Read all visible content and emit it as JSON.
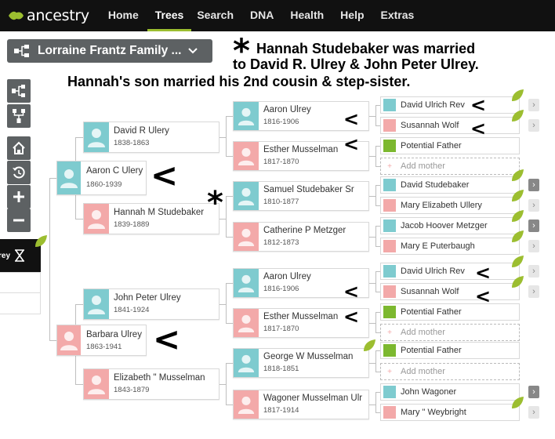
{
  "nav": {
    "logo": "ancestry",
    "items": [
      "Home",
      "Trees",
      "Search",
      "DNA",
      "Health",
      "Help",
      "Extras"
    ],
    "active": "Trees"
  },
  "tree_selector": {
    "label": "Lorraine Frantz Family ..."
  },
  "annotations": {
    "line1": "Hannah Studebaker was married",
    "line2": "to David R. Ulrey & John Peter Ulrey.",
    "line3": "Hannah's son married his 2nd cousin & step-sister.",
    "asterisk": "*",
    "lt": "<"
  },
  "side_panel": {
    "label": "Ulrey"
  },
  "people": {
    "aaron_c": {
      "name": "Aaron C Ulery",
      "dates": "1860-1939"
    },
    "barbara": {
      "name": "Barbara Ulrey",
      "dates": "1863-1941"
    },
    "david_r": {
      "name": "David R Ulery",
      "dates": "1838-1863"
    },
    "hannah": {
      "name": "Hannah M Studebaker",
      "dates": "1839-1889"
    },
    "john_peter": {
      "name": "John Peter Ulrey",
      "dates": "1841-1924"
    },
    "elizabeth": {
      "name": "Elizabeth \" Musselman",
      "dates": "1843-1879"
    },
    "aaron1": {
      "name": "Aaron Ulrey",
      "dates": "1816-1906"
    },
    "esther1": {
      "name": "Esther Musselman",
      "dates": "1817-1870"
    },
    "samuel": {
      "name": "Samuel Studebaker Sr",
      "dates": "1810-1877"
    },
    "catherine": {
      "name": "Catherine P Metzger",
      "dates": "1812-1873"
    },
    "aaron2": {
      "name": "Aaron Ulrey",
      "dates": "1816-1906"
    },
    "esther2": {
      "name": "Esther Musselman",
      "dates": "1817-1870"
    },
    "george": {
      "name": "George W Musselman",
      "dates": "1818-1851"
    },
    "wagoner": {
      "name": "Wagoner Musselman Ulr",
      "dates": "1817-1914"
    }
  },
  "small": {
    "s1": "David Ulrich Rev",
    "s2": "Susannah Wolf",
    "s3": "Potential Father",
    "s4": "Add mother",
    "s5": "David Studebaker",
    "s6": "Mary Elizabeth Ullery",
    "s7": "Jacob Hoover Metzger",
    "s8": "Mary E Puterbaugh",
    "s9": "David Ulrich Rev",
    "s10": "Susannah Wolf",
    "s11": "Potential Father",
    "s12": "Add mother",
    "s13": "Potential Father",
    "s14": "Add mother",
    "s15": "John Wagoner",
    "s16": "Mary \" Weybright"
  },
  "colors": {
    "male": "#7ecbcf",
    "female": "#f3a9a9",
    "accent": "#9cbe30",
    "topbar": "#111111"
  }
}
